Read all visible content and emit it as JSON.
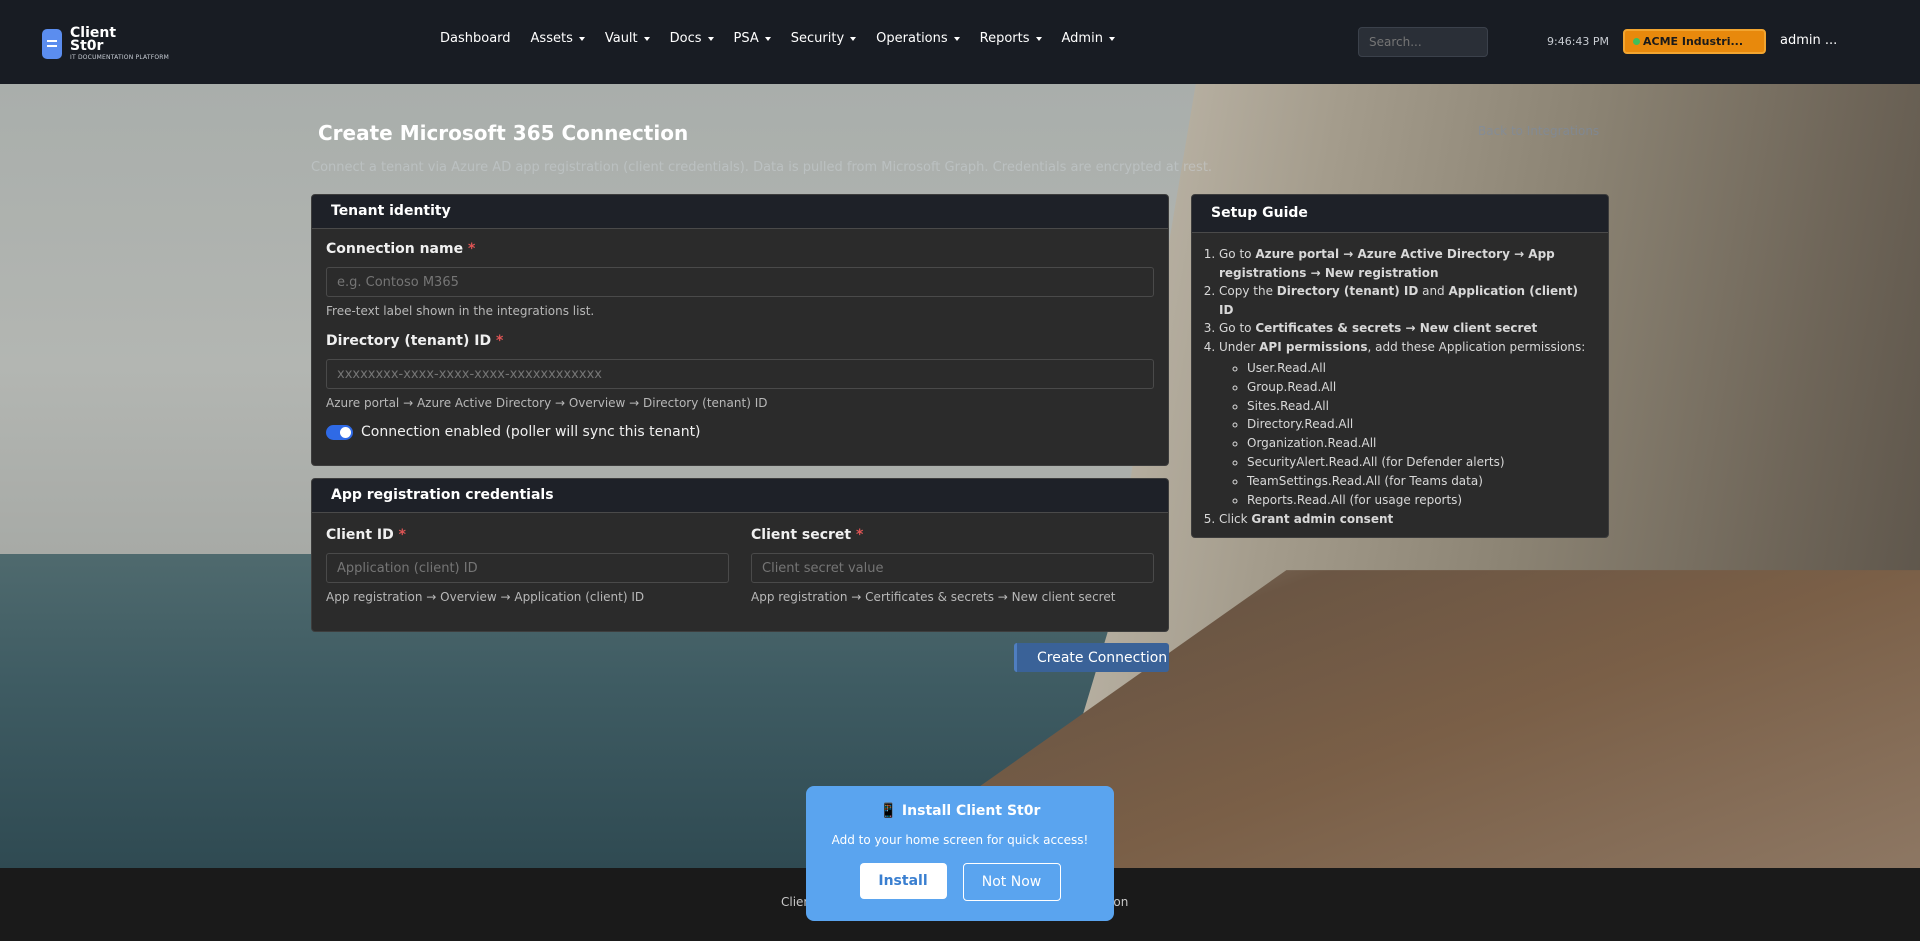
{
  "brand": {
    "name_line1": "Client",
    "name_line2": "St0r",
    "tagline": "IT DOCUMENTATION PLATFORM"
  },
  "nav": {
    "items": [
      {
        "label": "Dashboard",
        "dropdown": false
      },
      {
        "label": "Assets",
        "dropdown": true
      },
      {
        "label": "Vault",
        "dropdown": true
      },
      {
        "label": "Docs",
        "dropdown": true
      },
      {
        "label": "PSA",
        "dropdown": true
      },
      {
        "label": "Security",
        "dropdown": true
      },
      {
        "label": "Operations",
        "dropdown": true
      },
      {
        "label": "Reports",
        "dropdown": true
      },
      {
        "label": "Admin",
        "dropdown": true
      }
    ],
    "search_placeholder": "Search...",
    "time": "9:46:43 PM",
    "org": "ACME Industri...",
    "user": "admin ..."
  },
  "page": {
    "title": "Create Microsoft 365 Connection",
    "subtitle": "Connect a tenant via Azure AD app registration (client credentials). Data is pulled from Microsoft Graph. Credentials are encrypted at rest.",
    "back_link": "Back to Integrations"
  },
  "tenant_card": {
    "header": "Tenant identity",
    "connection_name": {
      "label": "Connection name",
      "placeholder": "e.g. Contoso M365",
      "help": "Free-text label shown in the integrations list."
    },
    "tenant_id": {
      "label": "Directory (tenant) ID",
      "placeholder": "xxxxxxxx-xxxx-xxxx-xxxx-xxxxxxxxxxxx",
      "help": "Azure portal → Azure Active Directory → Overview → Directory (tenant) ID"
    },
    "enabled_label": "Connection enabled (poller will sync this tenant)",
    "enabled": true
  },
  "credentials_card": {
    "header": "App registration credentials",
    "client_id": {
      "label": "Client ID",
      "placeholder": "Application (client) ID",
      "help": "App registration → Overview → Application (client) ID"
    },
    "client_secret": {
      "label": "Client secret",
      "placeholder": "Client secret value",
      "help": "App registration → Certificates & secrets → New client secret"
    }
  },
  "create_button": "Create Connection",
  "guide": {
    "header": "Setup Guide",
    "steps": {
      "s1_pre": "Go to ",
      "s1_bold": "Azure portal → Azure Active Directory → App registrations → New registration",
      "s2_pre": "Copy the ",
      "s2_b1": "Directory (tenant) ID",
      "s2_mid": " and ",
      "s2_b2": "Application (client) ID",
      "s3_pre": "Go to ",
      "s3_bold": "Certificates & secrets → New client secret",
      "s4_pre": "Under ",
      "s4_bold": "API permissions",
      "s4_post": ", add these Application permissions:",
      "permissions": [
        "User.Read.All",
        "Group.Read.All",
        "Sites.Read.All",
        "Directory.Read.All",
        "Organization.Read.All",
        "SecurityAlert.Read.All (for Defender alerts)",
        "TeamSettings.Read.All (for Teams data)",
        "Reports.Read.All (for usage reports)"
      ],
      "s5_pre": "Click ",
      "s5_bold": "Grant admin consent"
    }
  },
  "footer": {
    "left": "Clien",
    "right": "ation"
  },
  "install": {
    "title": "📱 Install Client St0r",
    "subtitle": "Add to your home screen for quick access!",
    "install_label": "Install",
    "notnow_label": "Not Now"
  },
  "colors": {
    "accent": "#2f6ae6",
    "org_badge": "#e8890c",
    "install_bg": "#5aa4ef",
    "required": "#e05555"
  }
}
